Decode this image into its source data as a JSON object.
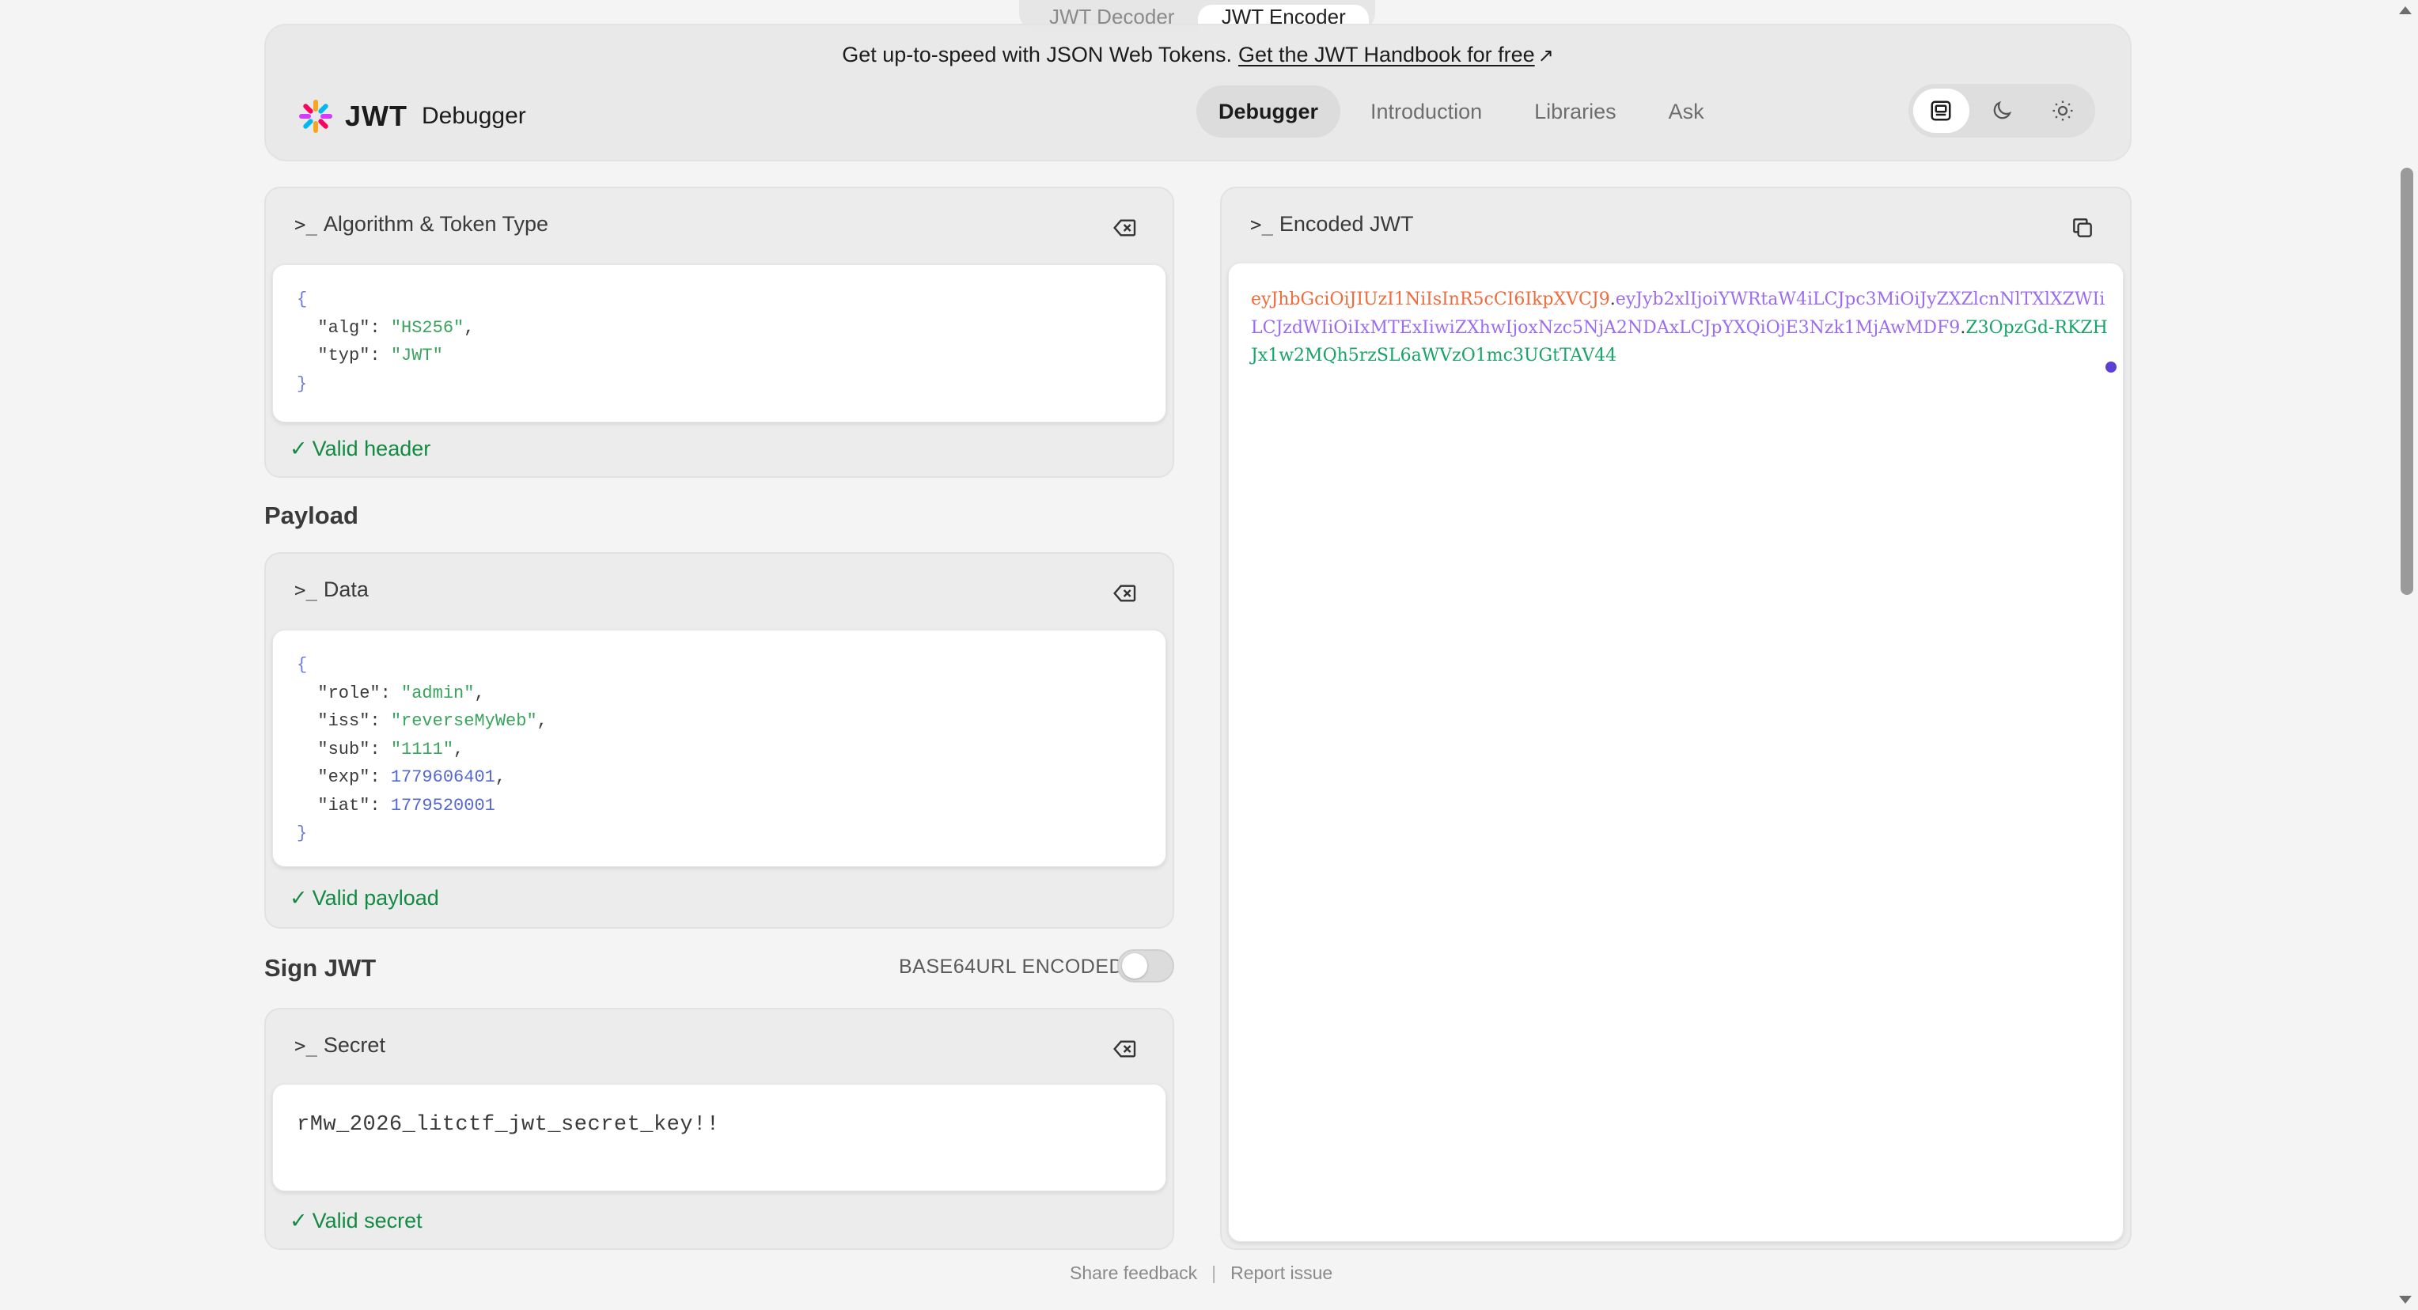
{
  "bg_tabs": [
    "JWT Decoder",
    "JWT Encoder"
  ],
  "banner": {
    "text": "Get up-to-speed with JSON Web Tokens.",
    "link": "Get the JWT Handbook for free",
    "arrow": "↗"
  },
  "logo": {
    "mark": "JWT",
    "sub": "Debugger"
  },
  "nav": [
    {
      "label": "Debugger",
      "active": true
    },
    {
      "label": "Introduction"
    },
    {
      "label": "Libraries"
    },
    {
      "label": "Ask"
    }
  ],
  "theme": [
    "system-icon",
    "moon-icon",
    "sun-icon"
  ],
  "header_section": {
    "panel_title": "Algorithm & Token Type",
    "code": {
      "alg": "\"HS256\"",
      "typ": "\"JWT\""
    },
    "valid": "Valid header"
  },
  "payload": {
    "section_title": "Payload",
    "panel_title": "Data",
    "code": {
      "role": "\"admin\"",
      "iss": "\"reverseMyWeb\"",
      "sub": "\"1111\"",
      "exp": "1779606401",
      "iat": "1779520001"
    },
    "valid": "Valid payload"
  },
  "sign": {
    "section_title": "Sign JWT",
    "toggle_label": "BASE64URL ENCODED",
    "toggle_on": false,
    "panel_title": "Secret",
    "secret": "rMw_2026_litctf_jwt_secret_key!!",
    "valid": "Valid secret"
  },
  "encoded": {
    "panel_title": "Encoded JWT",
    "header_part": "eyJhbGciOiJIUzI1NiIsInR5cCI6IkpXVCJ9",
    "payload_part": "eyJyb2xlIjoiYWRtaW4iLCJpc3MiOiJyZXZlcnNlTXlXZWIiLCJzdWIiOiIxMTExIiwiZXhwIjoxNzc5NjA2NDAxLCJpYXQiOjE3Nzk1MjAwMDF9",
    "signature_part": "Z3OpzGd-RKZHJx1w2MQh5rzSL6aWVzO1mc3UGtTAV44"
  },
  "footer": {
    "feedback": "Share feedback",
    "sep": "|",
    "report": "Report issue"
  }
}
